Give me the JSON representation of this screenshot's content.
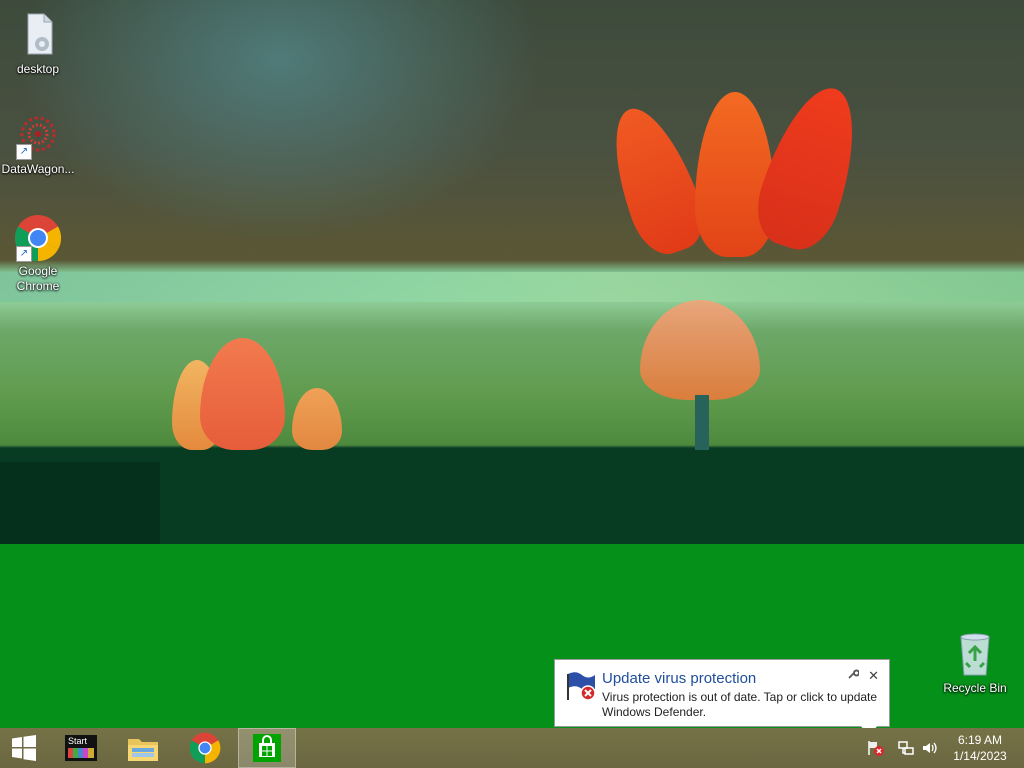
{
  "desktop_icons": [
    {
      "label": "desktop",
      "icon": "file-icon"
    },
    {
      "label": "DataWagon...",
      "icon": "datawagon-icon"
    },
    {
      "label": "Google Chrome",
      "icon": "chrome-icon"
    },
    {
      "label": "Recycle Bin",
      "icon": "recycle-bin-icon"
    }
  ],
  "taskbar": {
    "start_icon": "windows-start-icon",
    "pinned": [
      {
        "name": "Start",
        "icon": "start-menu-app-icon"
      },
      {
        "name": "File Explorer",
        "icon": "file-explorer-icon"
      },
      {
        "name": "Google Chrome",
        "icon": "chrome-icon"
      },
      {
        "name": "Store",
        "icon": "store-icon"
      }
    ],
    "start_app_label": "Start"
  },
  "tray": {
    "icons": [
      "action-center-alert-icon",
      "network-icon",
      "volume-icon"
    ],
    "time": "6:19 AM",
    "date": "1/14/2023"
  },
  "notification": {
    "title": "Update virus protection",
    "message": "Virus protection is out of date. Tap or click to update Windows Defender.",
    "close_glyph": "✕",
    "options_glyph": "🔧"
  },
  "colors": {
    "taskbar": "#6e6b44",
    "notification_title": "#1f4e9c",
    "chrome_red": "#db4437",
    "chrome_yellow": "#f4b400",
    "chrome_green": "#0f9d58",
    "chrome_blue": "#4285f4"
  }
}
